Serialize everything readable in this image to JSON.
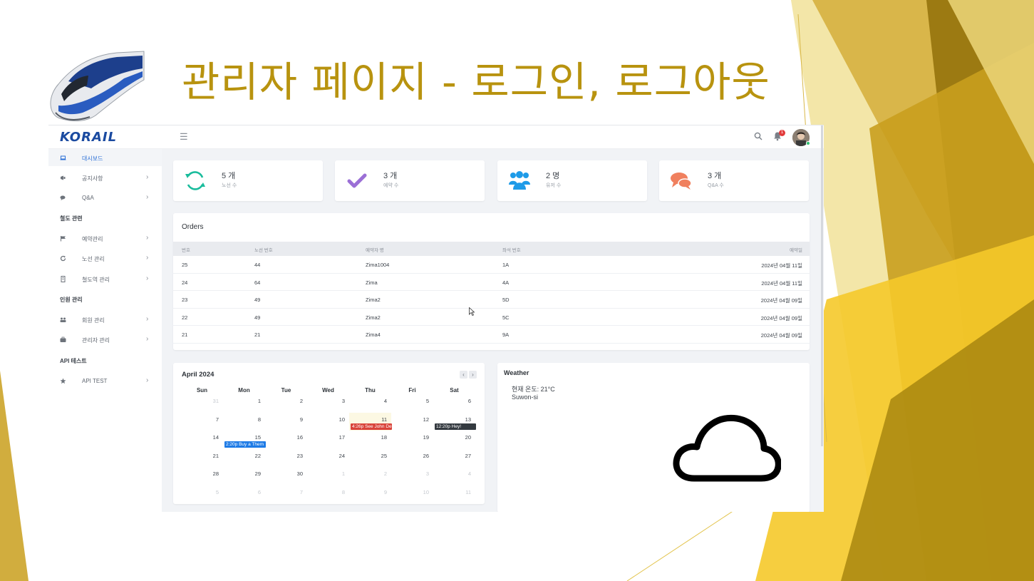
{
  "slide": {
    "title": "관리자 페이지 - 로그인, 로그아웃",
    "accent_color": "#b8930f"
  },
  "app": {
    "logo_text": "KORAIL",
    "hamburger_icon": "menu-icon",
    "notification_count": "1",
    "sidebar": {
      "dashboard": "대시보드",
      "notice": "공지사항",
      "qna": "Q&A",
      "section_railway": "철도 관련",
      "reservation": "예약관리",
      "route": "노선 관리",
      "station": "철도역 관리",
      "section_people": "인원 관리",
      "members": "회원 관리",
      "admins": "관리자 관리",
      "section_api": "API 테스트",
      "api_test": "API TEST"
    },
    "stats": [
      {
        "value": "5 개",
        "label": "노선 수",
        "icon": "sync-icon",
        "color": "#1abc9c"
      },
      {
        "value": "3 개",
        "label": "예약 수",
        "icon": "check-icon",
        "color": "#9b6fd6"
      },
      {
        "value": "2 명",
        "label": "유저 수",
        "icon": "users-icon",
        "color": "#1e9be8"
      },
      {
        "value": "3 개",
        "label": "Q&A 수",
        "icon": "comments-icon",
        "color": "#f0805e"
      }
    ],
    "orders": {
      "title": "Orders",
      "headers": [
        "번호",
        "노선 번호",
        "예약자 명",
        "좌석 번호",
        "예약일"
      ],
      "rows": [
        [
          "25",
          "44",
          "Zima1004",
          "1A",
          "2024년 04월 11일"
        ],
        [
          "24",
          "64",
          "Zima",
          "4A",
          "2024년 04월 11일"
        ],
        [
          "23",
          "49",
          "Zima2",
          "5D",
          "2024년 04월 09일"
        ],
        [
          "22",
          "49",
          "Zima2",
          "5C",
          "2024년 04월 09일"
        ],
        [
          "21",
          "21",
          "Zima4",
          "9A",
          "2024년 04월 09일"
        ]
      ]
    },
    "calendar": {
      "title": "April 2024",
      "prev": "‹",
      "next": "›",
      "weekdays": [
        "Sun",
        "Mon",
        "Tue",
        "Wed",
        "Thu",
        "Fri",
        "Sat"
      ],
      "weeks": [
        [
          "31",
          "1",
          "2",
          "3",
          "4",
          "5",
          "6"
        ],
        [
          "7",
          "8",
          "9",
          "10",
          "11",
          "12",
          "13"
        ],
        [
          "14",
          "15",
          "16",
          "17",
          "18",
          "19",
          "20"
        ],
        [
          "21",
          "22",
          "23",
          "24",
          "25",
          "26",
          "27"
        ],
        [
          "28",
          "29",
          "30",
          "1",
          "2",
          "3",
          "4"
        ],
        [
          "5",
          "6",
          "7",
          "8",
          "9",
          "10",
          "11"
        ]
      ],
      "events": [
        {
          "text": "4:26p See John De",
          "color": "#d9433a"
        },
        {
          "text": "12:20p Hey!",
          "color": "#343a40"
        },
        {
          "text": "2:20p Buy a Them",
          "color": "#1e7be6"
        }
      ]
    },
    "weather": {
      "title": "Weather",
      "temperature": "현재 온도: 21°C",
      "city": "Suwon-si",
      "icon": "cloud-icon"
    }
  }
}
